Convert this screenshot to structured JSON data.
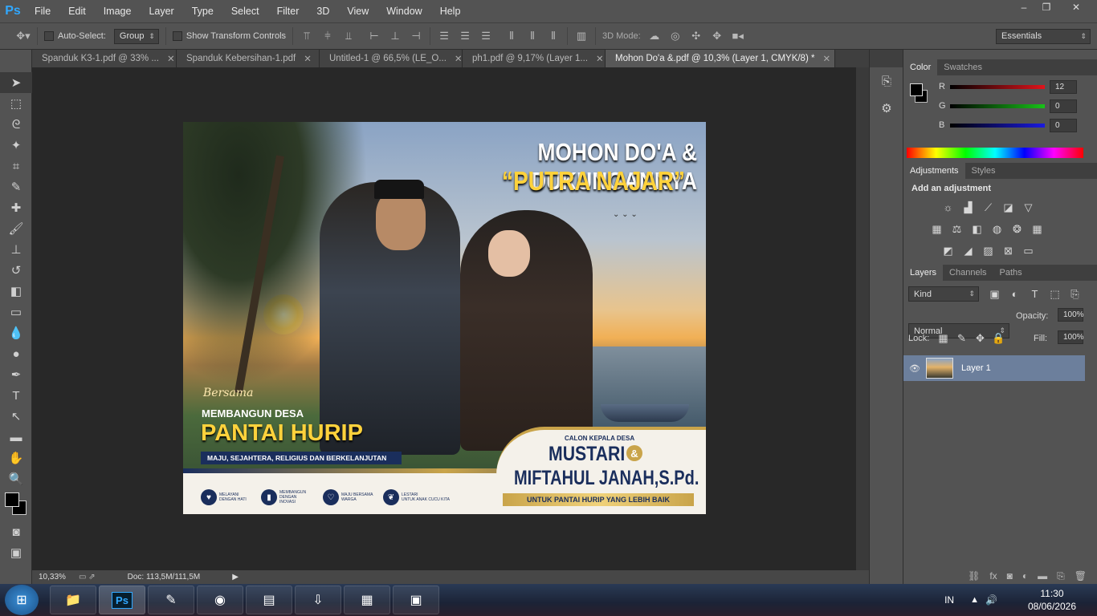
{
  "app": {
    "logo": "Ps",
    "window_controls": [
      "–",
      "❐",
      "✕"
    ]
  },
  "menu": [
    "File",
    "Edit",
    "Image",
    "Layer",
    "Type",
    "Select",
    "Filter",
    "3D",
    "View",
    "Window",
    "Help"
  ],
  "options": {
    "auto_select_label": "Auto-Select:",
    "auto_select_value": "Group",
    "show_transform_label": "Show Transform Controls",
    "mode_3d_label": "3D Mode:",
    "workspace": "Essentials"
  },
  "tabs": [
    {
      "label": "Spanduk K3-1.pdf @ 33% ..."
    },
    {
      "label": "Spanduk Kebersihan-1.pdf"
    },
    {
      "label": "Untitled-1 @ 66,5% (LE_O..."
    },
    {
      "label": "ph1.pdf @ 9,17% (Layer 1..."
    },
    {
      "label": "Mohon Do'a &.pdf @ 10,3% (Layer 1, CMYK/8) *"
    }
  ],
  "status": {
    "zoom": "10,33%",
    "doc": "Doc: 113,5M/111,5M"
  },
  "color_panel": {
    "tabs": [
      "Color",
      "Swatches"
    ],
    "r_label": "R",
    "r": "12",
    "g_label": "G",
    "g": "0",
    "b_label": "B",
    "b": "0",
    "r_color": "#e0141c",
    "g_color": "#18c218",
    "b_color": "#1a1ae0"
  },
  "adjustments": {
    "tabs": [
      "Adjustments",
      "Styles"
    ],
    "title": "Add an adjustment"
  },
  "layers": {
    "tabs": [
      "Layers",
      "Channels",
      "Paths"
    ],
    "kind": "Kind",
    "blend": "Normal",
    "opacity_label": "Opacity:",
    "opacity": "100%",
    "lock_label": "Lock:",
    "fill_label": "Fill:",
    "fill": "100%",
    "layer_name": "Layer 1"
  },
  "banner": {
    "headline": "MOHON DO'A & DUKUNGANNYA",
    "subheadline": "“PUTRA NAJAR”",
    "bersama": "Bersama",
    "membangun": "MEMBANGUN DESA",
    "village": "PANTAI HURIP",
    "tagline": "MAJU, SEJAHTERA, RELIGIUS DAN BERKELANJUTAN",
    "calon": "CALON KEPALA DESA",
    "name1": "MUSTARI",
    "amp": "&",
    "name2": "MIFTAHUL JANAH,S.Pd.",
    "slogan": "UNTUK PANTAI HURIP YANG LEBIH BAIK",
    "icons": [
      {
        "l1": "MELAYANI",
        "l2": "DENGAN HATI"
      },
      {
        "l1": "MEMBANGUN",
        "l2": "DENGAN INOVASI"
      },
      {
        "l1": "MAJU BERSAMA",
        "l2": "WARGA"
      },
      {
        "l1": "LESTARI",
        "l2": "UNTUK ANAK CUCU KITA"
      }
    ]
  },
  "taskbar": {
    "lang": "IN",
    "time": "11:30",
    "date": "08/06/2026"
  }
}
